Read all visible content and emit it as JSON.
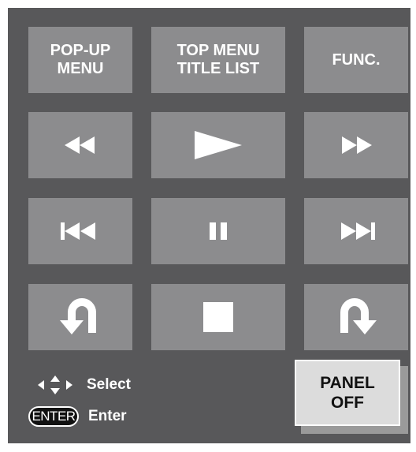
{
  "buttons": {
    "popup_menu": "POP-UP\nMENU",
    "top_menu": "TOP MENU\nTITLE LIST",
    "func": "FUNC."
  },
  "icons": {
    "rewind": "rewind-icon",
    "play": "play-icon",
    "fast_forward": "fast-forward-icon",
    "skip_back": "skip-back-icon",
    "pause": "pause-icon",
    "skip_forward": "skip-forward-icon",
    "replay": "replay-icon",
    "stop": "stop-icon",
    "skip_ahead": "skip-ahead-icon"
  },
  "hints": {
    "select_label": "Select",
    "enter_key": "ENTER",
    "enter_label": "Enter"
  },
  "panel_off": "PANEL\nOFF",
  "colors": {
    "background": "#58585a",
    "button": "#8c8c8e",
    "panel_off": "#dcdcdc",
    "text": "#ffffff"
  }
}
